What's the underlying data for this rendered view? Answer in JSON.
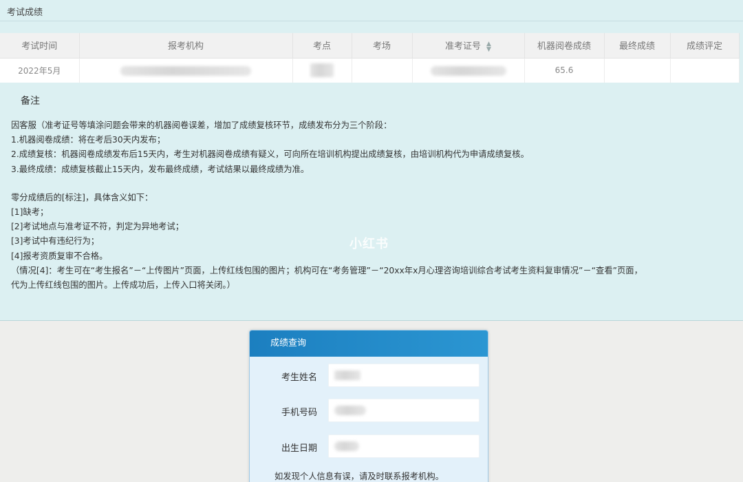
{
  "panel": {
    "title": "考试成绩"
  },
  "table": {
    "headers": [
      "考试时间",
      "报考机构",
      "考点",
      "考场",
      "准考证号",
      "机器阅卷成绩",
      "最终成绩",
      "成绩评定"
    ],
    "sortable_column_icon": "sort-icon",
    "row": {
      "exam_time": "2022年5月",
      "organization": "",
      "exam_site": "",
      "exam_room": "",
      "ticket_no": "",
      "machine_score": "65.6",
      "final_score": "",
      "rating": ""
    }
  },
  "remarks": {
    "heading": "备注",
    "lines": [
      "因客服（准考证号等填涂问题会带来的机器阅卷误差，增加了成绩复核环节，成绩发布分为三个阶段：",
      "1.机器阅卷成绩：将在考后30天内发布；",
      "2.成绩复核：机器阅卷成绩发布后15天内，考生对机器阅卷成绩有疑义，可向所在培训机构提出成绩复核，由培训机构代为申请成绩复核。",
      "3.最终成绩：成绩复核截止15天内，发布最终成绩，考试结果以最终成绩为准。"
    ],
    "lines2": [
      "零分成绩后的[标注]，具体含义如下：",
      "[1]缺考；",
      "[2]考试地点与准考证不符，判定为异地考试；",
      "[3]考试中有违纪行为；",
      "[4]报考资质复审不合格。",
      "（情况[4]：考生可在“考生报名”－“上传图片”页面，上传红线包围的图片；机构可在“考务管理”－“20xx年x月心理咨询培训综合考试考生资料复审情况”－“查看”页面，",
      "代为上传红线包围的图片。上传成功后，上传入口将关闭。）"
    ]
  },
  "watermark": "小红书",
  "query": {
    "title": "成绩查询",
    "fields": [
      {
        "label": "考生姓名"
      },
      {
        "label": "手机号码"
      },
      {
        "label": "出生日期"
      }
    ],
    "note": "如发现个人信息有误，请及时联系报考机构。"
  }
}
